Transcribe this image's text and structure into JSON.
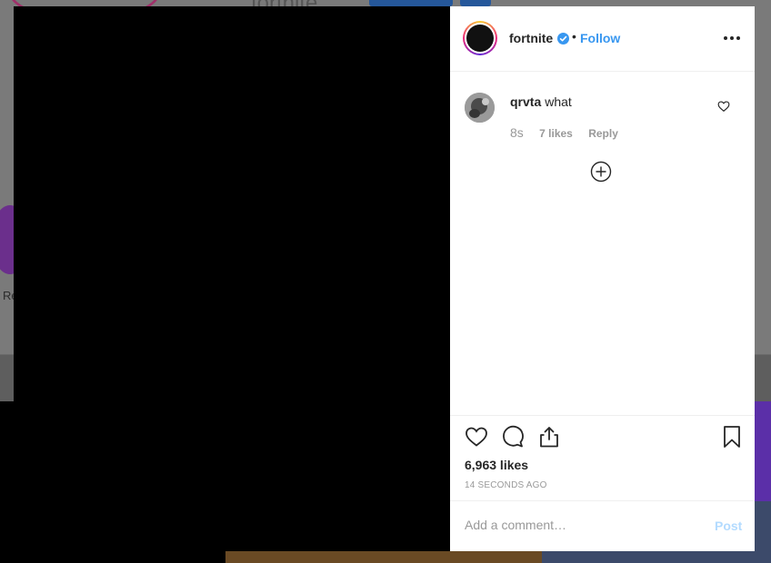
{
  "background": {
    "profile_title": "fortnite",
    "story_label": "Re"
  },
  "post": {
    "author": {
      "username": "fortnite",
      "verified": true,
      "separator": "•",
      "follow_label": "Follow"
    },
    "comments": [
      {
        "username": "qrvta",
        "text": "what",
        "time": "8s",
        "likes": "7 likes",
        "reply_label": "Reply"
      }
    ],
    "likes_count": "6,963 likes",
    "timestamp": "14 SECONDS AGO",
    "add_comment_placeholder": "Add a comment…",
    "post_label": "Post"
  },
  "icons": {
    "verified": "verified-badge-icon",
    "more": "more-options-icon",
    "heart": "heart-icon",
    "comment": "comment-icon",
    "share": "share-icon",
    "bookmark": "bookmark-icon",
    "load_more": "plus-circle-icon"
  },
  "colors": {
    "link": "#3897f0",
    "post_disabled": "#b3dbff",
    "text": "#262626",
    "muted": "#999999"
  }
}
